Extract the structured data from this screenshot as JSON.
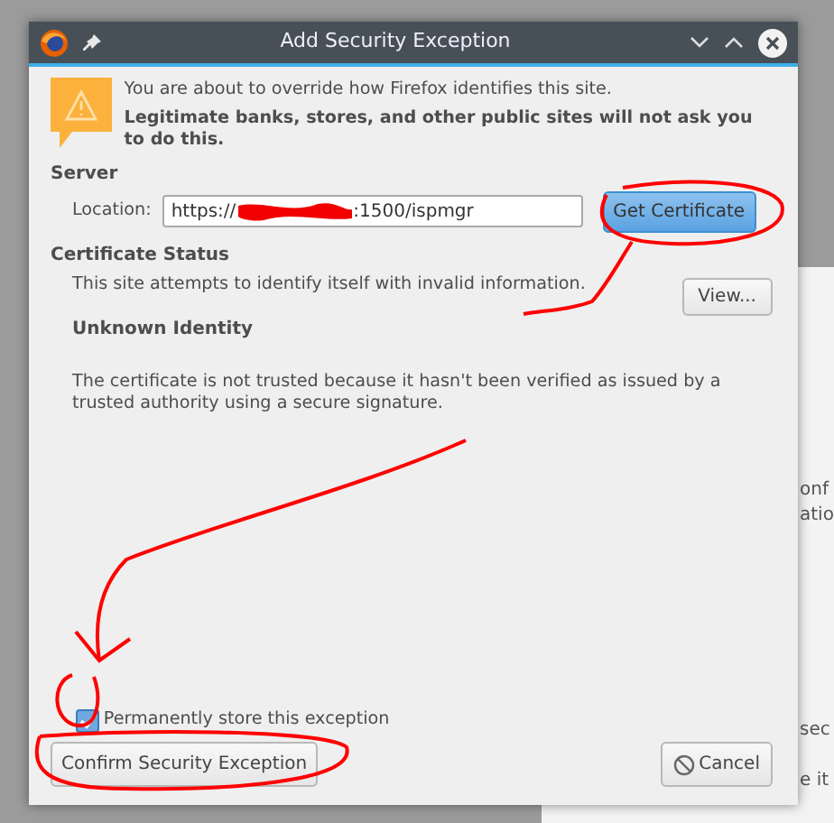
{
  "window": {
    "title": "Add Security Exception"
  },
  "warning": {
    "message": "You are about to override how Firefox identifies this site.",
    "note": "Legitimate banks, stores, and other public sites will not ask you to do this."
  },
  "server": {
    "heading": "Server",
    "location_label": "Location:",
    "location_start": "https://",
    "location_end": ":1500/ispmgr",
    "button": "Get Certificate"
  },
  "certificate_status": {
    "heading": "Certificate Status",
    "summary": "This site attempts to identify itself with invalid information.",
    "view_button": "View...",
    "problem_title": "Unknown Identity",
    "problem_text": "The certificate is not trusted because it hasn't been verified as issued by a trusted authority using a secure signature."
  },
  "permanent": {
    "label": "Permanently store this exception",
    "checked": true
  },
  "buttons": {
    "confirm": "Confirm Security Exception",
    "cancel": "Cancel"
  },
  "background_fragments": [
    {
      "text": "onf"
    },
    {
      "text": "atio"
    },
    {
      "text": "sec"
    },
    {
      "text": "e it"
    }
  ]
}
